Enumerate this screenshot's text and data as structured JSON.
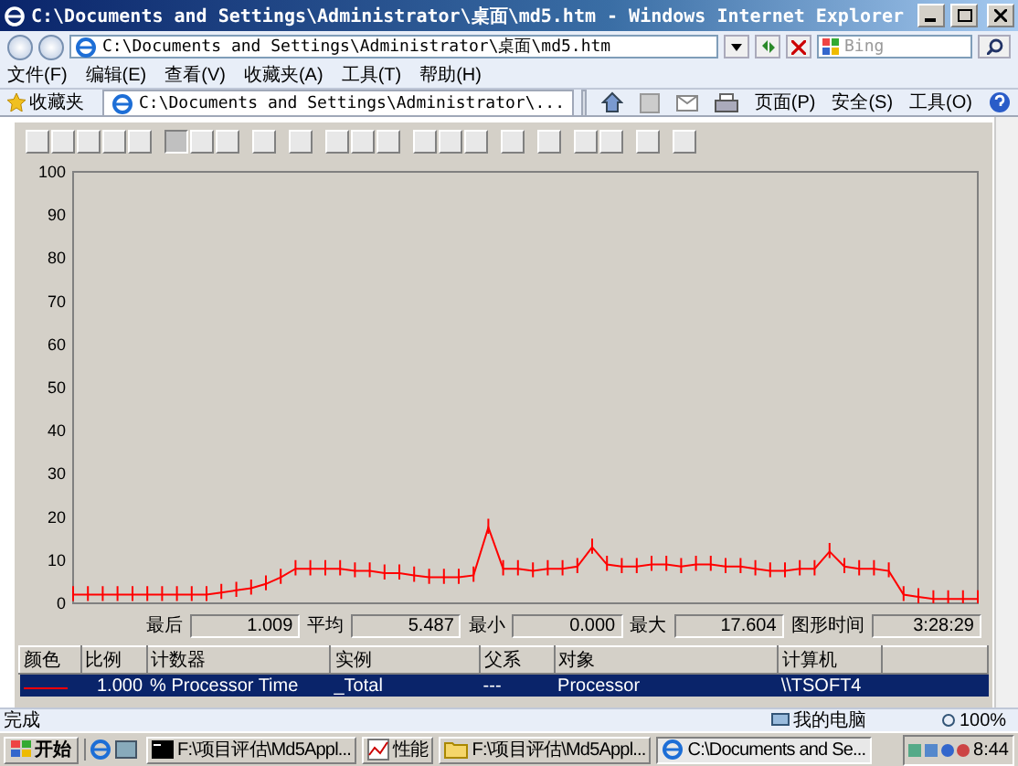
{
  "window": {
    "title": "C:\\Documents and Settings\\Administrator\\桌面\\md5.htm - Windows Internet Explorer"
  },
  "address_bar": {
    "value": "C:\\Documents and Settings\\Administrator\\桌面\\md5.htm"
  },
  "search": {
    "placeholder": "Bing"
  },
  "menu": [
    "文件(F)",
    "编辑(E)",
    "查看(V)",
    "收藏夹(A)",
    "工具(T)",
    "帮助(H)"
  ],
  "favorites": {
    "label": "收藏夹"
  },
  "tabs": [
    {
      "label": "C:\\Documents and Settings\\Administrator\\...",
      "selected": true
    }
  ],
  "command_bar": [
    {
      "kind": "icon"
    },
    {
      "kind": "icon"
    },
    {
      "kind": "icon"
    },
    {
      "kind": "icon"
    },
    {
      "kind": "menu",
      "label": "页面(P)"
    },
    {
      "kind": "menu",
      "label": "安全(S)"
    },
    {
      "kind": "menu",
      "label": "工具(O)"
    },
    {
      "kind": "icon"
    }
  ],
  "chart_data": {
    "type": "line",
    "yticks": [
      0,
      10,
      20,
      30,
      40,
      50,
      60,
      70,
      80,
      90,
      100
    ],
    "ylim": [
      0,
      100
    ],
    "series": [
      {
        "color": "#ff0000",
        "values": [
          2,
          2,
          2,
          2,
          2,
          2,
          2,
          2,
          2,
          2,
          2.5,
          3,
          3.5,
          4.5,
          6,
          8,
          8,
          8,
          8,
          7.5,
          7.5,
          7,
          7,
          6.5,
          6,
          6,
          6,
          6.5,
          17.6,
          8,
          8,
          7.5,
          8,
          8,
          8.5,
          13,
          9,
          8.5,
          8.5,
          9,
          9,
          8.5,
          9,
          9,
          8.5,
          8.5,
          8,
          7.5,
          7.5,
          8,
          8,
          12,
          8.5,
          8,
          8,
          7.5,
          2,
          1.5,
          1,
          1,
          1,
          1
        ]
      }
    ]
  },
  "stats": [
    {
      "label": "最后",
      "value": "1.009"
    },
    {
      "label": "平均",
      "value": "5.487"
    },
    {
      "label": "最小",
      "value": "0.000"
    },
    {
      "label": "最大",
      "value": "17.604"
    },
    {
      "label": "图形时间",
      "value": "3:28:29"
    }
  ],
  "counters": {
    "columns": [
      "颜色",
      "比例",
      "计数器",
      "实例",
      "父系",
      "对象",
      "计算机"
    ],
    "rows": [
      {
        "color": "#ff0000",
        "scale": "1.000",
        "counter": "% Processor Time",
        "instance": "_Total",
        "parent": "---",
        "object": "Processor",
        "computer": "\\\\TSOFT4",
        "selected": true
      }
    ]
  },
  "status_bar": {
    "text": "完成",
    "zone": "我的电脑",
    "zoom": "100%"
  },
  "taskbar": {
    "start": "开始",
    "tasks": [
      {
        "label": "F:\\项目评估\\Md5Appl...",
        "selected": false
      },
      {
        "label": "性能",
        "selected": false
      },
      {
        "label": "F:\\项目评估\\Md5Appl...",
        "selected": false
      },
      {
        "label": "C:\\Documents and Se...",
        "selected": true
      }
    ],
    "clock": "8:44"
  }
}
